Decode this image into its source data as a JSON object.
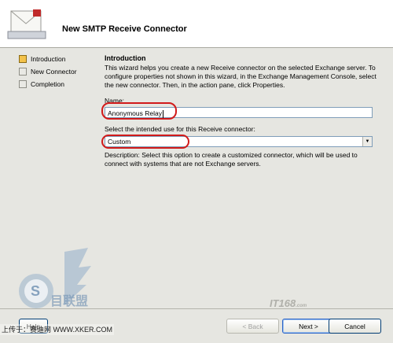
{
  "window": {
    "title": "New SMTP Receive Connector"
  },
  "steps": [
    {
      "label": "Introduction",
      "state": "current"
    },
    {
      "label": "New Connector",
      "state": "pending"
    },
    {
      "label": "Completion",
      "state": "pending"
    }
  ],
  "intro": {
    "heading": "Introduction",
    "text": "This wizard helps you create a new Receive connector on the selected Exchange server. To configure properties not shown in this wizard, in the Exchange Management Console, select the new connector. Then, in the action pane, click Properties."
  },
  "name_field": {
    "label": "Name:",
    "value": "Anonymous Relay"
  },
  "use_field": {
    "label": "Select the intended use for this Receive connector:",
    "value": "Custom"
  },
  "description": "Description: Select this option to create a customized connector, which will be used to connect with systems that are not Exchange servers.",
  "buttons": {
    "help": "Help",
    "back": "< Back",
    "next": "Next >",
    "cancel": "Cancel"
  },
  "watermark": {
    "text": "上传于：赛迪网 WWW.XKER.COM",
    "badge": "IT168",
    "badge_suffix": ".com",
    "logo": "S 目联盟"
  },
  "colors": {
    "highlight": "#d11a1a",
    "current_step": "#f3c24a"
  },
  "icons": {
    "wizard": "envelope-icon",
    "step_current": "current-step-icon",
    "step_pending": "pending-step-icon",
    "dropdown": "chevron-down-icon"
  }
}
